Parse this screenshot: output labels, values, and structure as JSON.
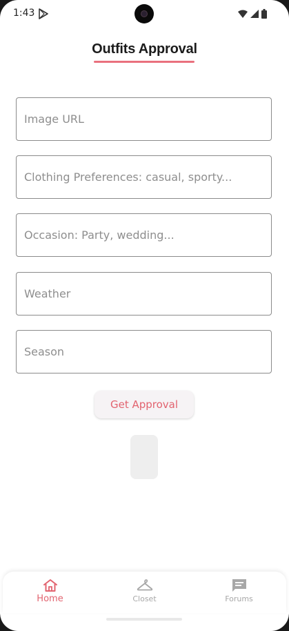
{
  "status_bar": {
    "time": "1:43"
  },
  "header": {
    "title": "Outfits Approval"
  },
  "form": {
    "image_url_placeholder": "Image URL",
    "preferences_placeholder": "Clothing Preferences: casual, sporty...",
    "occasion_placeholder": "Occasion: Party, wedding...",
    "weather_placeholder": "Weather",
    "season_placeholder": "Season"
  },
  "actions": {
    "get_approval_label": "Get Approval"
  },
  "nav": {
    "items": [
      {
        "label": "Home",
        "icon": "home-icon",
        "active": true
      },
      {
        "label": "Closet",
        "icon": "hanger-icon",
        "active": false
      },
      {
        "label": "Forums",
        "icon": "chat-icon",
        "active": false
      }
    ]
  },
  "colors": {
    "accent": "#e2636f",
    "underline": "#e9707d",
    "inactive": "#a7a7a7"
  }
}
